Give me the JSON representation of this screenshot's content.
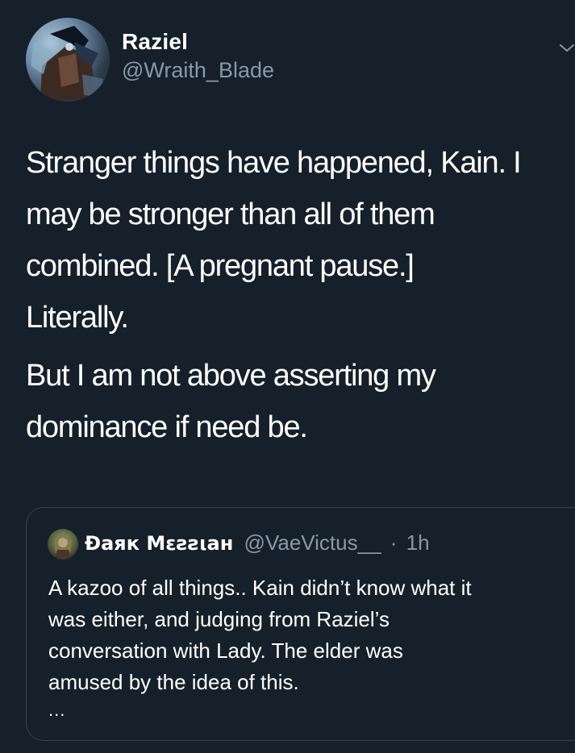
{
  "tweet": {
    "author": {
      "display_name": "Raziel",
      "handle": "@Wraith_Blade",
      "avatar_icon": "profile-avatar"
    },
    "menu_icon": "chevron-down-icon",
    "body": {
      "paragraph1_lines": [
        "Stranger things have happened, Kain. I",
        "may be stronger than all of them",
        "combined. [A pregnant pause.]",
        "Literally."
      ],
      "paragraph2_lines": [
        "But I am not above asserting my",
        "dominance if need be."
      ]
    },
    "quoted_tweet": {
      "display_name": "Ɖаяк Мεƨƨιан",
      "handle": "@VaeVictus__",
      "separator": "·",
      "time": "1h",
      "lines": [
        "A kazoo of all things.. Kain didn’t know what it",
        "was either, and judging from Raziel’s",
        "conversation with Lady. The elder was",
        "amused by the idea of this."
      ],
      "truncation": "..."
    }
  },
  "colors": {
    "background": "#15202b",
    "text_primary": "#ffffff",
    "text_secondary": "#8899a6",
    "border": "#38444d"
  }
}
